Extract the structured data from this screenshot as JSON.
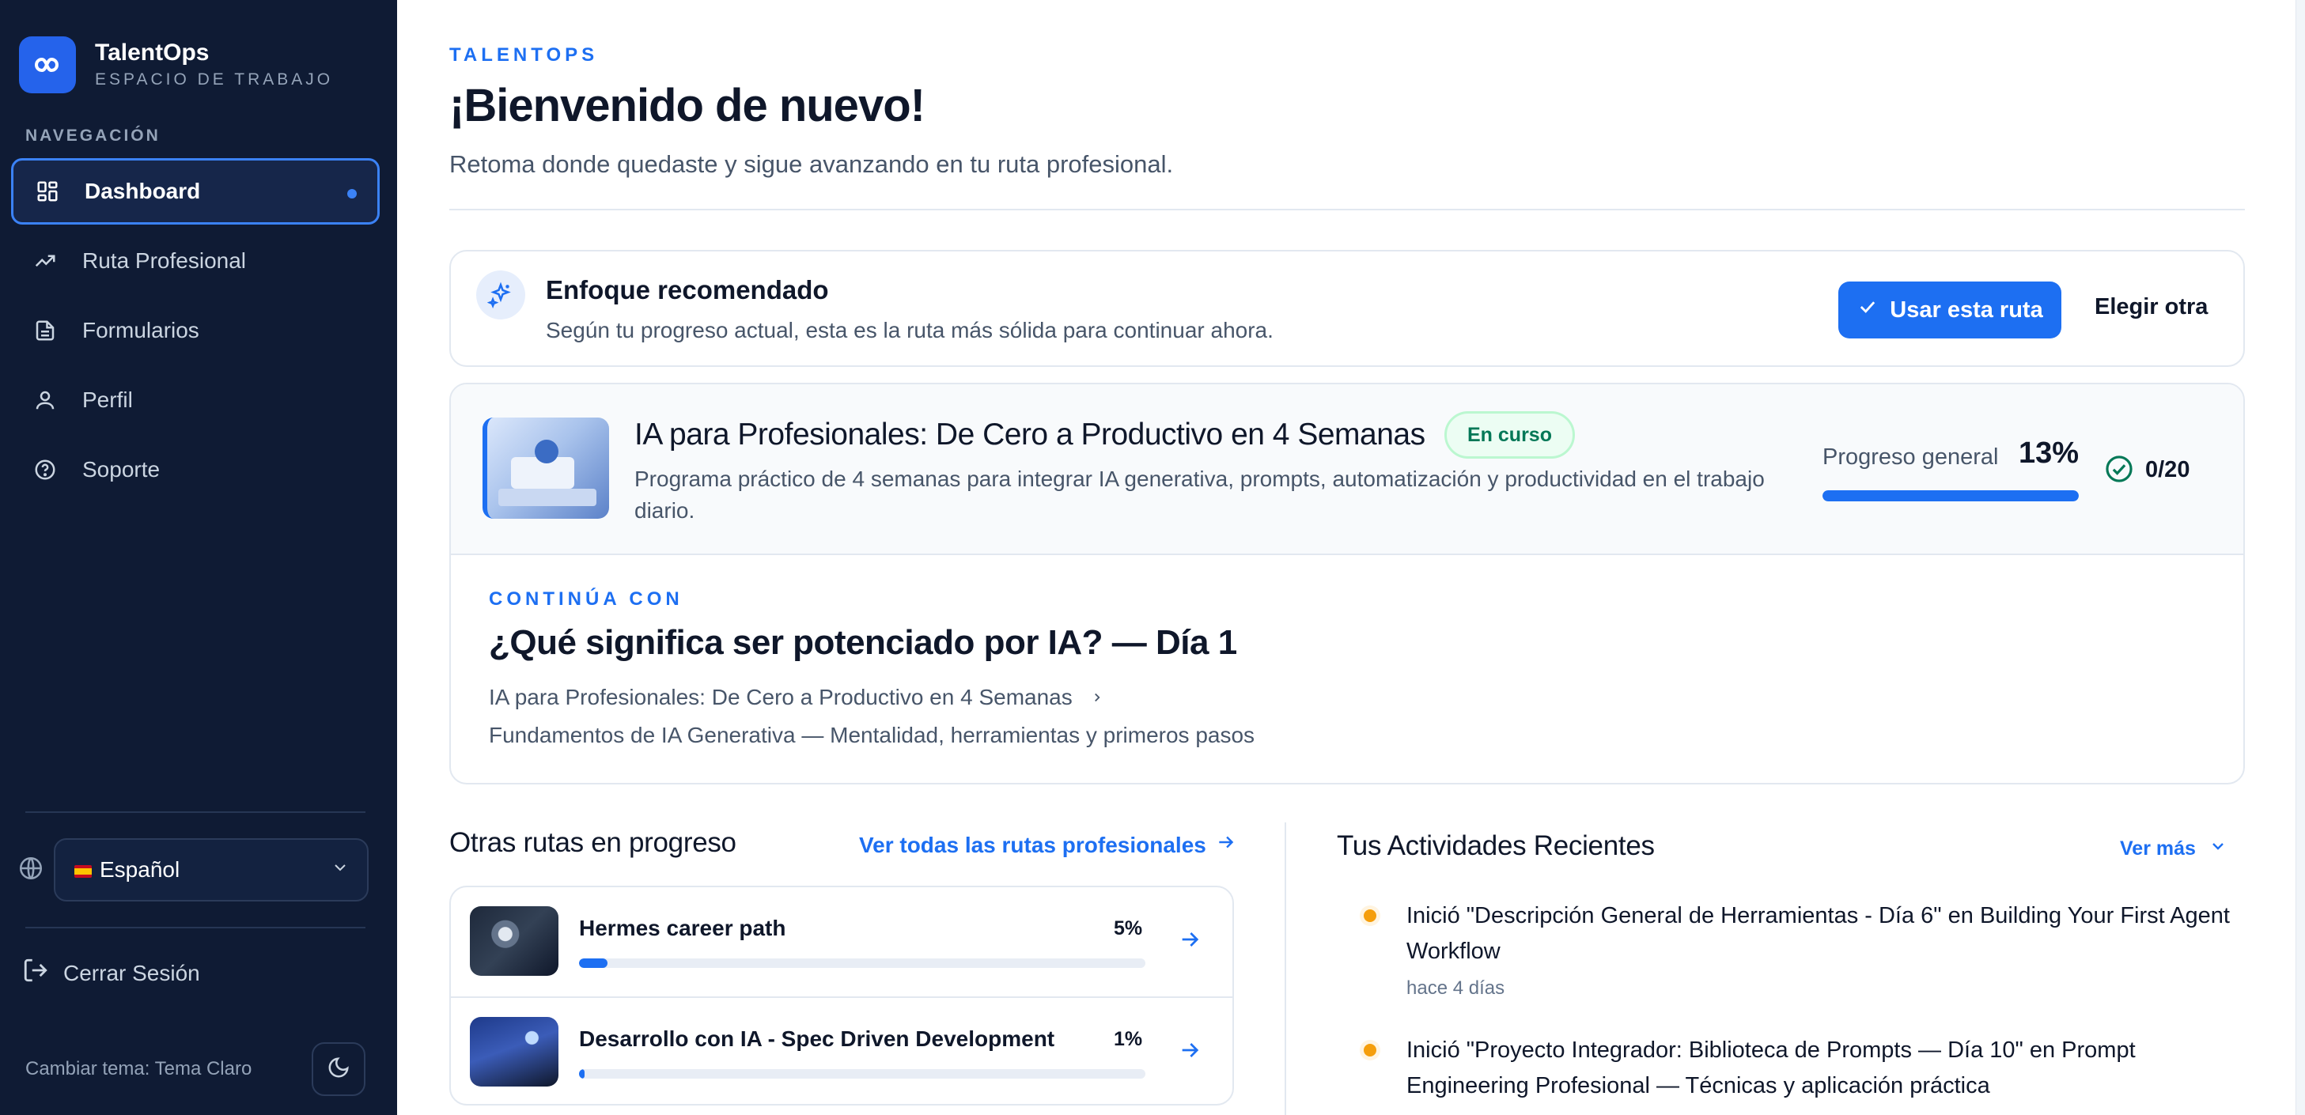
{
  "brand": {
    "name": "TalentOps",
    "subtitle": "ESPACIO DE TRABAJO"
  },
  "sidebar": {
    "nav_label": "NAVEGACIÓN",
    "items": [
      {
        "label": "Dashboard",
        "icon": "dashboard-grid-icon",
        "active": true
      },
      {
        "label": "Ruta Profesional",
        "icon": "trending-up-icon"
      },
      {
        "label": "Formularios",
        "icon": "document-icon"
      },
      {
        "label": "Perfil",
        "icon": "user-icon"
      },
      {
        "label": "Soporte",
        "icon": "help-circle-icon"
      }
    ],
    "language": "Español",
    "logout": "Cerrar Sesión",
    "theme_label": "Cambiar tema: Tema Claro"
  },
  "header": {
    "eyebrow": "TALENTOPS",
    "title": "¡Bienvenido de nuevo!",
    "subtitle": "Retoma donde quedaste y sigue avanzando en tu ruta profesional."
  },
  "recommendation": {
    "title": "Enfoque recomendado",
    "description": "Según tu progreso actual, esta es la ruta más sólida para continuar ahora.",
    "primary_button": "Usar esta ruta",
    "secondary_button": "Elegir otra"
  },
  "course": {
    "title": "IA para Profesionales: De Cero a Productivo en 4 Semanas",
    "status_badge": "En curso",
    "description": "Programa práctico de 4 semanas para integrar IA generativa, prompts, automatización y productividad en el trabajo diario.",
    "progress_label": "Progreso general",
    "progress_value": 13,
    "progress_text": "13%",
    "completed_text": "0/20",
    "continue_eyebrow": "CONTINÚA CON",
    "continue_title": "¿Qué significa ser potenciado por IA? — Día 1",
    "breadcrumb_course": "IA para Profesionales: De Cero a Productivo en 4 Semanas",
    "breadcrumb_module": "Fundamentos de IA Generativa — Mentalidad, herramientas y primeros pasos"
  },
  "other_routes": {
    "title": "Otras rutas en progreso",
    "link": "Ver todas las rutas profesionales",
    "items": [
      {
        "name": "Hermes career path",
        "progress": 5,
        "progress_text": "5%"
      },
      {
        "name": "Desarrollo con IA - Spec Driven Development",
        "progress": 1,
        "progress_text": "1%"
      }
    ]
  },
  "activities": {
    "title": "Tus Actividades Recientes",
    "more": "Ver más",
    "items": [
      {
        "text": "Inició \"Descripción General de Herramientas - Día 6\" en Building Your First Agent Workflow",
        "time": "hace 4 días"
      },
      {
        "text": "Inició \"Proyecto Integrador: Biblioteca de Prompts — Día 10\" en Prompt Engineering Profesional — Técnicas y aplicación práctica",
        "time": ""
      }
    ]
  },
  "colors": {
    "accent": "#1d6ff2",
    "sidebar_bg": "#0f1b34",
    "success": "#047857",
    "activity_dot": "#f59e0b"
  }
}
